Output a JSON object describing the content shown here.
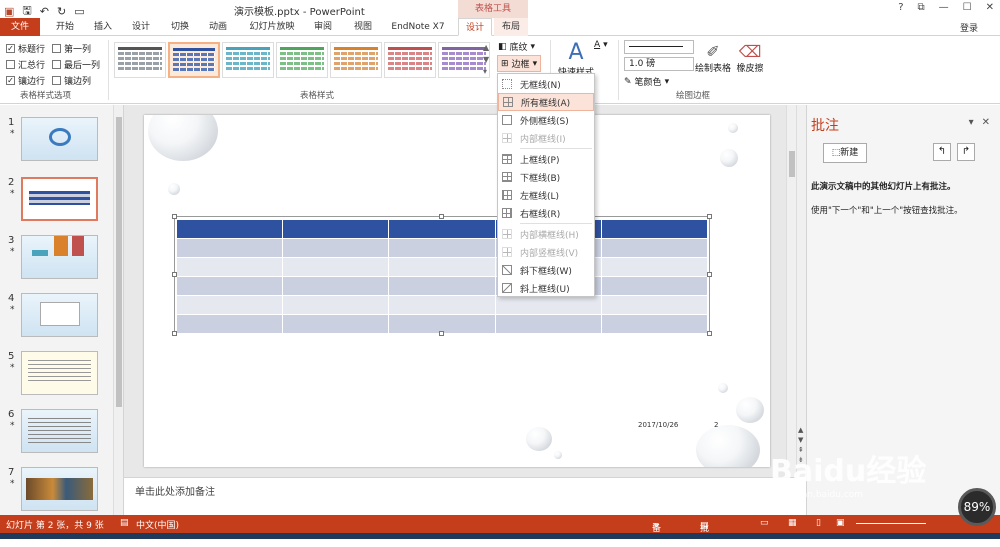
{
  "titlebar": {
    "title": "演示模板.pptx - PowerPoint",
    "context_group": "表格工具",
    "help": "?",
    "ribbon_display": "⧉",
    "minimize": "—",
    "maximize": "☐",
    "close": "✕"
  },
  "tabs": [
    {
      "label": "文件"
    },
    {
      "label": "开始"
    },
    {
      "label": "插入"
    },
    {
      "label": "设计"
    },
    {
      "label": "切换"
    },
    {
      "label": "动画"
    },
    {
      "label": "幻灯片放映"
    },
    {
      "label": "审阅"
    },
    {
      "label": "视图"
    },
    {
      "label": "EndNote X7"
    },
    {
      "label": "设计"
    },
    {
      "label": "布局"
    }
  ],
  "signin": "登录",
  "ribbon": {
    "options": {
      "header_row": "标题行",
      "first_column": "第一列",
      "total_row": "汇总行",
      "last_column": "最后一列",
      "banded_rows": "镶边行",
      "banded_columns": "镶边列",
      "group_label": "表格样式选项"
    },
    "styles_group_label": "表格样式",
    "shading": "底纹",
    "borders": "边框",
    "quick_styles": "快速样式",
    "pen_weight": "1.0 磅",
    "pen_color": "笔颜色",
    "draw_table": "绘制表格",
    "eraser": "橡皮擦",
    "draw_borders_label": "绘图边框"
  },
  "border_menu": [
    {
      "label": "无框线(N)",
      "disabled": false,
      "highlight": false
    },
    {
      "label": "所有框线(A)",
      "disabled": false,
      "highlight": true
    },
    {
      "label": "外侧框线(S)",
      "disabled": false,
      "highlight": false
    },
    {
      "label": "内部框线(I)",
      "disabled": true,
      "highlight": false
    },
    {
      "label": "上框线(P)",
      "disabled": false,
      "highlight": false
    },
    {
      "label": "下框线(B)",
      "disabled": false,
      "highlight": false
    },
    {
      "label": "左框线(L)",
      "disabled": false,
      "highlight": false
    },
    {
      "label": "右框线(R)",
      "disabled": false,
      "highlight": false
    },
    {
      "label": "内部横框线(H)",
      "disabled": true,
      "highlight": false
    },
    {
      "label": "内部竖框线(V)",
      "disabled": true,
      "highlight": false
    },
    {
      "label": "斜下框线(W)",
      "disabled": false,
      "highlight": false
    },
    {
      "label": "斜上框线(U)",
      "disabled": false,
      "highlight": false
    }
  ],
  "slides": [
    {
      "num": "1",
      "star": "*"
    },
    {
      "num": "2",
      "star": "*"
    },
    {
      "num": "3",
      "star": "*"
    },
    {
      "num": "4",
      "star": "*"
    },
    {
      "num": "5",
      "star": "*"
    },
    {
      "num": "6",
      "star": "*"
    },
    {
      "num": "7",
      "star": "*"
    }
  ],
  "slide": {
    "date": "2017/10/26",
    "page": "2"
  },
  "notes_placeholder": "单击此处添加备注",
  "comments": {
    "title": "批注",
    "new": "新建",
    "msg1": "此演示文稿中的其他幻灯片上有批注。",
    "msg2": "使用\"下一个\"和\"上一个\"按钮查找批注。"
  },
  "status": {
    "slide_info": "幻灯片 第 2 张，共 9 张",
    "language": "中文(中国)",
    "notes": "备注",
    "comments": "批注"
  },
  "overlay": {
    "speed": "89%",
    "watermark": "Baidu经验",
    "watermark_url": "jingyan.baidu.com"
  },
  "colors": {
    "accent": "#c43e1c",
    "table_header": "#2f52a0",
    "band_dark": "#cbd0e1",
    "band_light": "#e6e8f0"
  }
}
